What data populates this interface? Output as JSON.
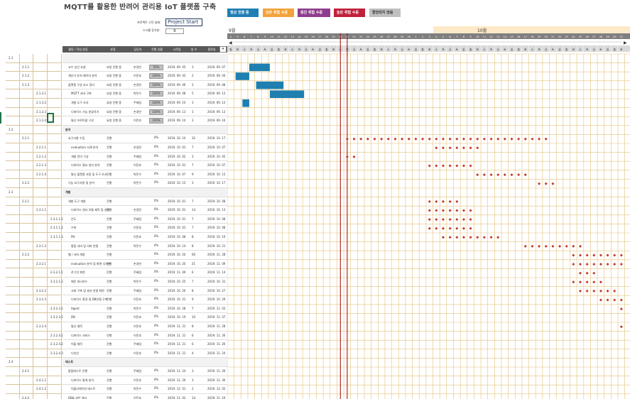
{
  "title": "MQTT를 활용한 반려어 관리용 IoT 플랫폼 구축",
  "project_start_label": "프로젝트 시작 날짜:",
  "project_start_value": "Project Start",
  "increment_label": "스크롤 증가분:",
  "increment_value": "0",
  "legend": [
    {
      "label": "정상 진행 중",
      "color": "#1f7fb4"
    },
    {
      "label": "낮은 위험 수준",
      "color": "#f2a23a"
    },
    {
      "label": "중간 위험 수준",
      "color": "#8e3d8e"
    },
    {
      "label": "높은 위험 수준",
      "color": "#c0203a"
    },
    {
      "label": "할당되지 않음",
      "color": "#bfbfbf"
    }
  ],
  "columns": [
    "WBS",
    "",
    "",
    "",
    "",
    "활동 / 작업 분류",
    "분류",
    "담당자",
    "진행 상황",
    "시작일",
    "일 수",
    "종료일"
  ],
  "months": [
    "9월",
    "10월"
  ],
  "status_colors": {
    "bar": "#1e7fb0",
    "diamond": "#c0392b",
    "today": "#a00000",
    "grid": "#e3c07a"
  },
  "rows": [
    {
      "wbs": "2.1",
      "lvl": 0,
      "name": "",
      "cat": "",
      "owner": "",
      "prog": "",
      "start": "",
      "days": "",
      "end": ""
    },
    {
      "wbs": "2.1.1",
      "lvl": 1,
      "name": "교수 승인 요청",
      "cat": "요청 진행 중",
      "owner": "손경빈",
      "prog": "50%",
      "start": "2019. 09. 05",
      "days": "3",
      "end": "2019. 09. 07"
    },
    {
      "wbs": "2.1.2",
      "lvl": 1,
      "name": "계산기 유저 페이지 분석",
      "cat": "요청 진행 중",
      "owner": "이민호",
      "prog": "100%",
      "start": "2019. 09. 03",
      "days": "2",
      "end": "2019. 09. 04"
    },
    {
      "wbs": "2.1.3",
      "lvl": 1,
      "name": "플랫폼 구성 요소 정리",
      "cat": "요청 진행 중",
      "owner": "손경빈",
      "prog": "100%",
      "start": "2019. 09. 06",
      "days": "3",
      "end": "2019. 09. 08"
    },
    {
      "wbs": "2.1.3.1",
      "lvl": 2,
      "name": "MQTT 서버 구축",
      "cat": "요청 진행 중",
      "owner": "박민수",
      "prog": "100%",
      "start": "2019. 09. 08",
      "days": "5",
      "end": "2019. 09. 12"
    },
    {
      "wbs": "2.1.3.2",
      "lvl": 2,
      "name": "개발 도구 조사",
      "cat": "요청 진행 중",
      "owner": "주혜림",
      "prog": "100%",
      "start": "2019. 09. 10",
      "days": "3",
      "end": "2019. 09. 12"
    },
    {
      "wbs": "2.1.3.3",
      "lvl": 2,
      "name": "디바이스 기능 분류하기",
      "cat": "요청 진행 중",
      "owner": "손경빈",
      "prog": "100%",
      "start": "2019. 09. 13",
      "days": "3",
      "end": "2019. 09. 13"
    },
    {
      "wbs": "2.1.3.4",
      "lvl": 2,
      "name": "통신 프로토콜 구성",
      "cat": "요청 진행 중",
      "owner": "이민호",
      "prog": "100%",
      "start": "2019. 09. 14",
      "days": "3",
      "end": "2019. 09. 16"
    },
    {
      "wbs": "2.2",
      "lvl": 0,
      "name": "분석",
      "cat": "",
      "owner": "",
      "prog": "",
      "start": "",
      "days": "",
      "end": ""
    },
    {
      "wbs": "2.2.1",
      "lvl": 1,
      "name": "요구사항 수집",
      "cat": "진행",
      "owner": "",
      "prog": "0%",
      "start": "2019. 10. 10",
      "days": "32",
      "end": "2019. 10. 17"
    },
    {
      "wbs": "2.2.1.1",
      "lvl": 2,
      "name": "evaluation 사례 분석",
      "cat": "진행",
      "owner": "손경빈",
      "prog": "0%",
      "start": "2019. 10. 01",
      "days": "7",
      "end": "2019. 10. 07"
    },
    {
      "wbs": "2.2.1.2",
      "lvl": 2,
      "name": "개발 언어 구상",
      "cat": "진행",
      "owner": "주혜림",
      "prog": "0%",
      "start": "2019. 10. 02",
      "days": "3",
      "end": "2019. 10. 05"
    },
    {
      "wbs": "2.2.1.3",
      "lvl": 2,
      "name": "디바이스 필요 센서 분석",
      "cat": "진행",
      "owner": "이민호",
      "prog": "0%",
      "start": "2019. 10. 01",
      "days": "7",
      "end": "2019. 10. 07"
    },
    {
      "wbs": "2.2.1.4",
      "lvl": 2,
      "name": "통신 플랫폼 사용 및 도구 조사",
      "cat": "진행",
      "owner": "박민수",
      "prog": "0%",
      "start": "2019. 10. 07",
      "days": "9",
      "end": "2019. 10. 15"
    },
    {
      "wbs": "2.2.2",
      "lvl": 1,
      "name": "기능 요구사항 및 분석",
      "cat": "진행",
      "owner": "박민수",
      "prog": "0%",
      "start": "2019. 10. 15",
      "days": "3",
      "end": "2019. 10. 17"
    },
    {
      "wbs": "2.3",
      "lvl": 0,
      "name": "개발",
      "cat": "",
      "owner": "",
      "prog": "",
      "start": "",
      "days": "",
      "end": ""
    },
    {
      "wbs": "2.3.1",
      "lvl": 1,
      "name": "개발 도구 개발",
      "cat": "진행",
      "owner": "",
      "prog": "0%",
      "start": "2019. 10. 01",
      "days": "7",
      "end": "2019. 10. 08"
    },
    {
      "wbs": "2.3.1.1",
      "lvl": 2,
      "name": "디바이스 센서 모듈 제작 및 설정",
      "cat": "진행",
      "owner": "손경빈",
      "prog": "0%",
      "start": "2019. 10. 01",
      "days": "14",
      "end": "2019. 10. 13"
    },
    {
      "wbs": "2.3.1.1.1",
      "lvl": 3,
      "name": "온도",
      "cat": "진행",
      "owner": "주혜림",
      "prog": "0%",
      "start": "2019. 10. 01",
      "days": "7",
      "end": "2019. 10. 08"
    },
    {
      "wbs": "2.3.1.1.2",
      "lvl": 3,
      "name": "수위",
      "cat": "진행",
      "owner": "이민호",
      "prog": "0%",
      "start": "2019. 10. 01",
      "days": "7",
      "end": "2019. 10. 08"
    },
    {
      "wbs": "2.3.1.1.3",
      "lvl": 3,
      "name": "PH",
      "cat": "진행",
      "owner": "이민호",
      "prog": "0%",
      "start": "2019. 10. 08",
      "days": "8",
      "end": "2019. 10. 19"
    },
    {
      "wbs": "2.3.1.2",
      "lvl": 2,
      "name": "통합 서버 및 서버 연결",
      "cat": "진행",
      "owner": "박민수",
      "prog": "0%",
      "start": "2019. 10. 14",
      "days": "8",
      "end": "2019. 10. 21"
    },
    {
      "wbs": "2.3.2",
      "lvl": 1,
      "name": "웹 / 서버 개발",
      "cat": "진행",
      "owner": "",
      "prog": "0%",
      "start": "2019. 10. 20",
      "days": "60",
      "end": "2019. 11. 28"
    },
    {
      "wbs": "2.3.2.1",
      "lvl": 2,
      "name": "evaluation 분석 및 화면 디자인",
      "cat": "진행",
      "owner": "손경빈",
      "prog": "0%",
      "start": "2019. 10. 20",
      "days": "21",
      "end": "2019. 11. 09"
    },
    {
      "wbs": "2.3.2.1.1",
      "lvl": 3,
      "name": "로그인 화면",
      "cat": "진행",
      "owner": "주혜림",
      "prog": "0%",
      "start": "2019. 11. 09",
      "days": "6",
      "end": "2019. 11. 14"
    },
    {
      "wbs": "2.3.2.1.2",
      "lvl": 3,
      "name": "메인 대시보드",
      "cat": "진행",
      "owner": "박민수",
      "prog": "0%",
      "start": "2019. 10. 25",
      "days": "7",
      "end": "2019. 10. 31"
    },
    {
      "wbs": "2.3.2.2",
      "lvl": 2,
      "name": "서버 구축 및 센서 연결 화면",
      "cat": "진행",
      "owner": "주혜림",
      "prog": "0%",
      "start": "2019. 10. 20",
      "days": "8",
      "end": "2019. 10. 27"
    },
    {
      "wbs": "2.3.2.3",
      "lvl": 2,
      "name": "디바이스 환경 및 DB연결 구축",
      "cat": "진행",
      "owner": "이민호",
      "prog": "0%",
      "start": "2019. 10. 21",
      "days": "9",
      "end": "2019. 10. 29"
    },
    {
      "wbs": "2.3.2.3.1",
      "lvl": 3,
      "name": "Agent",
      "cat": "진행",
      "owner": "박민수",
      "prog": "0%",
      "start": "2019. 10. 28",
      "days": "7",
      "end": "2019. 11. 03"
    },
    {
      "wbs": "2.3.2.3.2",
      "lvl": 3,
      "name": "DB",
      "cat": "진행",
      "owner": "이민호",
      "prog": "0%",
      "start": "2019. 10. 19",
      "days": "10",
      "end": "2019. 11. 07"
    },
    {
      "wbs": "2.3.2.4",
      "lvl": 2,
      "name": "통신 제작",
      "cat": "진행",
      "owner": "이민호",
      "prog": "0%",
      "start": "2019. 11. 21",
      "days": "8",
      "end": "2019. 11. 28"
    },
    {
      "wbs": "2.3.2.4.1",
      "lvl": 3,
      "name": "디바이스 서비스",
      "cat": "진행",
      "owner": "이민호",
      "prog": "0%",
      "start": "2019. 11. 21",
      "days": "6",
      "end": "2019. 11. 26"
    },
    {
      "wbs": "2.3.2.4.2",
      "lvl": 3,
      "name": "어플 제작",
      "cat": "진행",
      "owner": "주혜림",
      "prog": "0%",
      "start": "2019. 11. 21",
      "days": "6",
      "end": "2019. 11. 26"
    },
    {
      "wbs": "2.3.2.4.3",
      "lvl": 3,
      "name": "디자인",
      "cat": "진행",
      "owner": "이민호",
      "prog": "0%",
      "start": "2019. 11. 21",
      "days": "4",
      "end": "2019. 11. 24"
    },
    {
      "wbs": "2.4",
      "lvl": 0,
      "name": "테스트",
      "cat": "",
      "owner": "",
      "prog": "",
      "start": "",
      "days": "",
      "end": ""
    },
    {
      "wbs": "2.4.1",
      "lvl": 1,
      "name": "통합테스트 진행",
      "cat": "진행",
      "owner": "주혜림",
      "prog": "0%",
      "start": "2019. 11. 24",
      "days": "3",
      "end": "2019. 11. 26"
    },
    {
      "wbs": "2.4.1.1",
      "lvl": 2,
      "name": "디바이스 통계 분석",
      "cat": "진행",
      "owner": "이민호",
      "prog": "0%",
      "start": "2019. 11. 29",
      "days": "3",
      "end": "2019. 11. 30"
    },
    {
      "wbs": "2.4.1.2",
      "lvl": 2,
      "name": "어플리케이션 테스트",
      "cat": "진행",
      "owner": "박민수",
      "prog": "0%",
      "start": "2019. 12. 01",
      "days": "2",
      "end": "2019. 12. 02"
    },
    {
      "wbs": "2.4.2",
      "lvl": 1,
      "name": "DB& 보안 체크",
      "cat": "진행",
      "owner": "이민호",
      "prog": "0%",
      "start": "2019. 11. 02",
      "days": "14",
      "end": "2019. 11. 16"
    }
  ]
}
